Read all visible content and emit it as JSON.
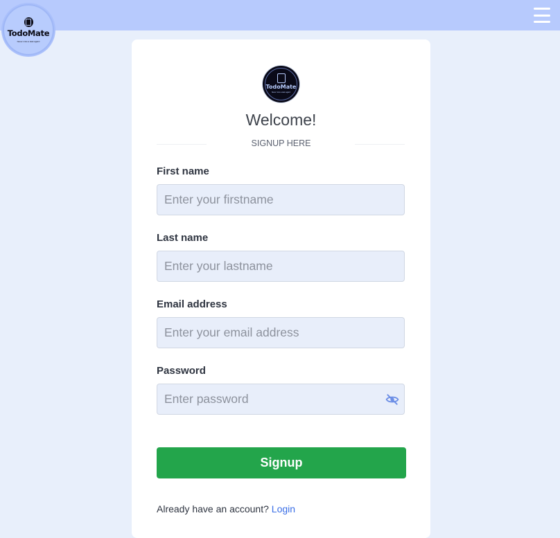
{
  "header": {
    "brand_name": "TodoMate",
    "brand_tagline": "Never miss a task again!",
    "menu_icon": "hamburger-menu-icon"
  },
  "card": {
    "logo_name": "TodoMate",
    "logo_tagline": "Never miss a task again!",
    "welcome": "Welcome!",
    "subtitle": "SIGNUP HERE"
  },
  "form": {
    "first_name": {
      "label": "First name",
      "placeholder": "Enter your firstname",
      "value": ""
    },
    "last_name": {
      "label": "Last name",
      "placeholder": "Enter your lastname",
      "value": ""
    },
    "email": {
      "label": "Email address",
      "placeholder": "Enter your email address",
      "value": ""
    },
    "password": {
      "label": "Password",
      "placeholder": "Enter password",
      "value": "",
      "toggle_icon": "eye-off-icon"
    },
    "submit_label": "Signup"
  },
  "footer": {
    "prompt": "Already have an account?",
    "login_link": "Login"
  },
  "colors": {
    "topbar": "#b7cafd",
    "page_bg": "#e8effb",
    "primary_button": "#23a54b",
    "link": "#3a6ee6"
  }
}
